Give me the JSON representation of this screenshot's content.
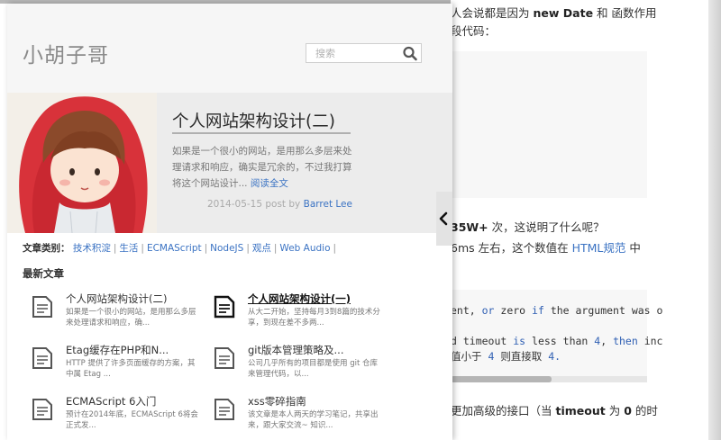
{
  "background_article": {
    "line1_prefix": "人会说都是因为",
    "line1_kw1": "new Date",
    "line1_mid": "和",
    "line1_suffix": "函数作用",
    "line2": "段代码：",
    "line3_prefix": "35W+",
    "line3_suffix": "次，这说明了什么呢？",
    "line4_prefix": "6ms 左右，这个数值在",
    "line4_link": "HTML规范",
    "line4_suffix": "中",
    "code1_a": "ent, ",
    "code1_or": "or",
    "code1_b": " zero ",
    "code1_if": "if",
    "code1_c": " the argument was o",
    "code2_a": "d timeout ",
    "code2_is": "is",
    "code2_b": " less than ",
    "code2_num": "4",
    "code2_c": ", ",
    "code2_then": "then",
    "code2_d": " inc",
    "code3_prefix": "值小于",
    "code3_num": "4",
    "code3_suffix": "则直接取",
    "code3_num2": "4.",
    "line5_prefix": "更加高级的接口（当",
    "line5_kw": "timeout",
    "line5_mid": "为",
    "line5_num": "0",
    "line5_suffix": "的时"
  },
  "sidebar": {
    "site_title": "小胡子哥",
    "search": {
      "placeholder": "搜索"
    },
    "featured": {
      "title": "个人网站架构设计(二)",
      "excerpt": "如果是一个很小的网站，是用那么多层来处理请求和响应，确实是冗余的，不过我打算将这个网站设计...",
      "read_more": "阅读全文",
      "date": "2014-05-15",
      "post_by": "post by",
      "author": "Barret Lee"
    },
    "categories": {
      "label": "文章类别：",
      "items": [
        "技术积淀",
        "生活",
        "ECMAScript",
        "NodeJS",
        "观点",
        "Web Audio"
      ]
    },
    "recent_heading": "最新文章",
    "recent_posts": [
      {
        "title": "个人网站架构设计(二)",
        "excerpt": "如果是一个很小的网站，是用那么多层来处理请求和响应，确..."
      },
      {
        "title": "个人网站架构设计(一)",
        "excerpt": "从大二开始，坚持每月3到8篇的技术分享，到现在差不多两..."
      },
      {
        "title": "Etag缓存在PHP和N...",
        "excerpt": "HTTP 提供了许多页面缓存的方案，其中属 Etag ..."
      },
      {
        "title": "git版本管理策略及...",
        "excerpt": "公司几乎所有的项目都是使用 git 仓库来管理代码，以..."
      },
      {
        "title": "ECMAScript 6入门",
        "excerpt": "预计在2014年底，ECMAScript 6将会正式发..."
      },
      {
        "title": "xss零碎指南",
        "excerpt": "该文章是本人两天的学习笔记，共享出来，跟大家交流~ 知识..."
      }
    ]
  },
  "colors": {
    "link": "#3b73c3",
    "header_bg": "#f6f6f6",
    "featured_bg": "#ececec"
  }
}
